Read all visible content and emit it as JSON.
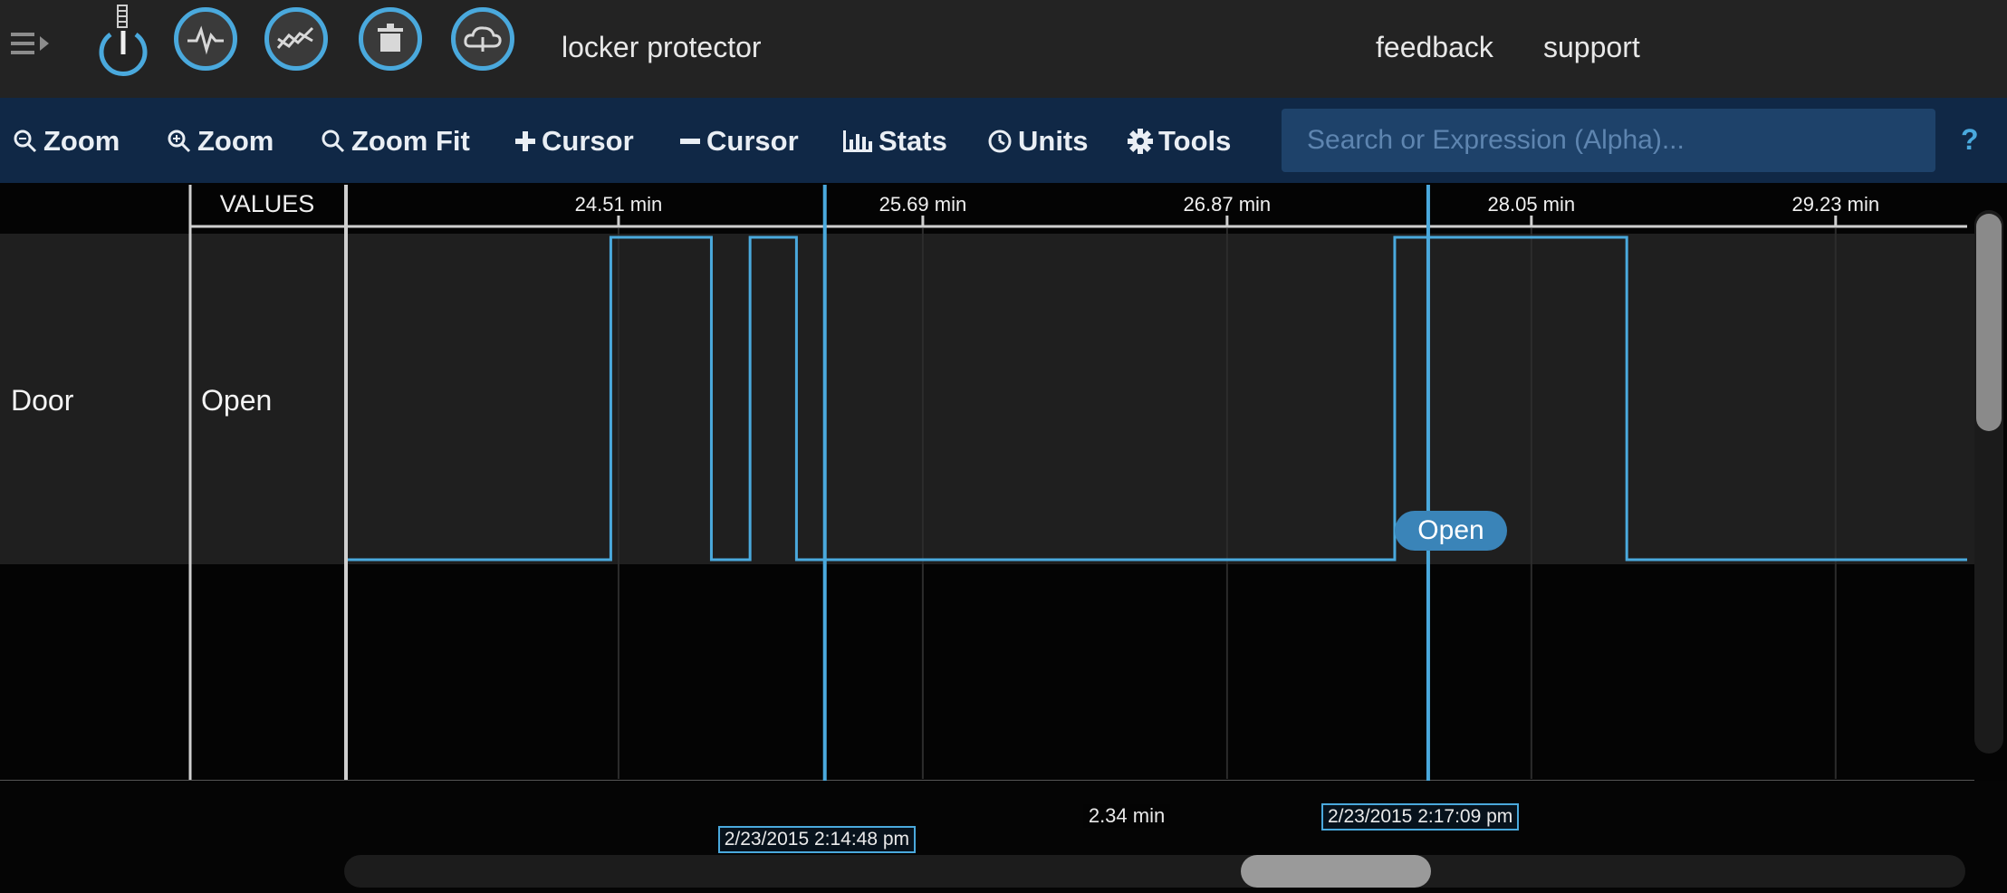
{
  "app": {
    "title": "locker protector"
  },
  "topnav": {
    "feedback": "feedback",
    "support": "support"
  },
  "toolbar": {
    "zoom_out": "Zoom",
    "zoom_in": "Zoom",
    "zoom_fit": "Zoom Fit",
    "add_cursor": "Cursor",
    "remove_cursor": "Cursor",
    "stats": "Stats",
    "units": "Units",
    "tools": "Tools",
    "search_placeholder": "Search or Expression (Alpha)...",
    "help": "?"
  },
  "table": {
    "values_header": "VALUES",
    "rows": [
      {
        "name": "Door",
        "value": "Open"
      }
    ]
  },
  "chart_data": {
    "type": "line",
    "x_unit": "min",
    "x_ticks": [
      "24.51 min",
      "25.69 min",
      "26.87 min",
      "28.05 min",
      "29.23 min"
    ],
    "tick_values": [
      24.51,
      25.69,
      26.87,
      28.05,
      29.23
    ],
    "xlim": [
      23.46,
      29.74
    ],
    "series": [
      {
        "name": "Door",
        "step": true,
        "x": [
          23.46,
          24.48,
          24.48,
          24.87,
          24.87,
          25.02,
          25.02,
          25.2,
          25.2,
          27.52,
          27.52,
          28.42,
          28.42,
          29.74
        ],
        "y": [
          0,
          0,
          1,
          1,
          0,
          0,
          1,
          1,
          0,
          0,
          1,
          1,
          0,
          0
        ]
      }
    ],
    "cursors": [
      {
        "x": 25.31,
        "label": "2/23/2015 2:14:48 pm"
      },
      {
        "x": 27.65,
        "label": "2/23/2015 2:17:09 pm"
      }
    ],
    "cursor_delta": "2.34 min",
    "hover_value": "Open",
    "line_color": "#4aa9dd"
  }
}
